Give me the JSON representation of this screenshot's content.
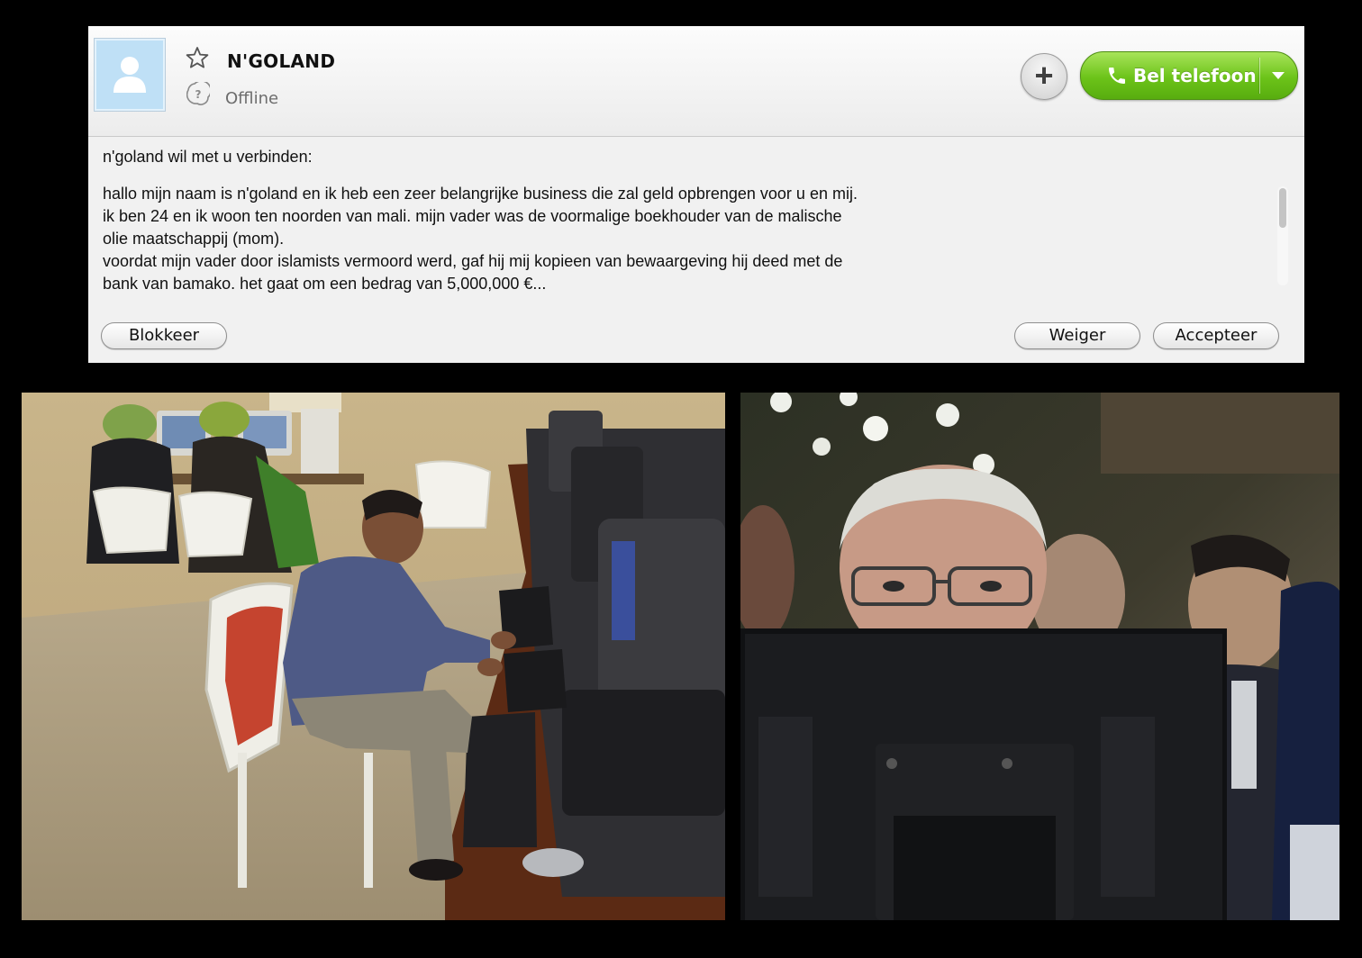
{
  "contact": {
    "name": "N'GOLAND",
    "status": "Offline"
  },
  "actions": {
    "add_icon": "plus-icon",
    "call_label": "Bel telefoon",
    "call_icon": "phone-icon",
    "dropdown_icon": "chevron-down-icon"
  },
  "request": {
    "intro": "n'goland wil met u verbinden:",
    "message": "hallo mijn naam is n'goland en ik heb een zeer belangrijke business die zal geld opbrengen voor u en mij.\nik ben 24 en ik woon ten noorden van mali. mijn vader was de voormalige boekhouder van de malische\nolie maatschappij (mom).\nvoordat mijn vader door islamists vermoord werd, gaf hij mij kopieen van bewaargeving hij deed met de\nbank van bamako. het gaat om een bedrag van 5,000,000 €..."
  },
  "buttons": {
    "block": "Blokkeer",
    "decline": "Weiger",
    "accept": "Accepteer"
  },
  "colors": {
    "call_green": "#6cc319",
    "avatar_blue": "#bfe0f6",
    "panel_bg": "#f1f1f1"
  }
}
